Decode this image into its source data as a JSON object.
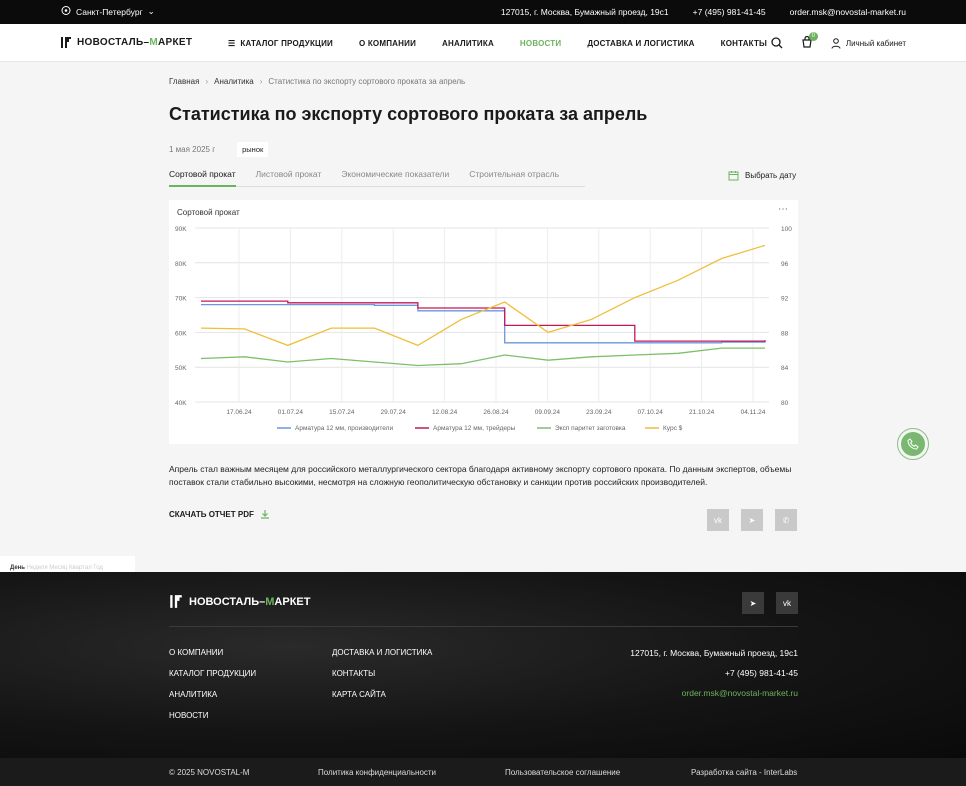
{
  "topbar": {
    "city": "Санкт-Петербург",
    "address": "127015, г. Москва, Бумажный проезд, 19с1",
    "phone": "+7 (495) 981-41-45",
    "email": "order.msk@novostal-market.ru"
  },
  "logo": {
    "part1": "НОВОСТАЛЬ–",
    "part2": "М",
    "part3": "АРКЕТ"
  },
  "nav": {
    "catalog": "КАТАЛОГ ПРОДУКЦИИ",
    "about": "О КОМПАНИИ",
    "analytics": "АНАЛИТИКА",
    "news": "НОВОСТИ",
    "delivery": "ДОСТАВКА И ЛОГИСТИКА",
    "contacts": "КОНТАКТЫ"
  },
  "header": {
    "cart_count": "0",
    "account": "Личный кабинет"
  },
  "breadcrumb": {
    "home": "Главная",
    "section": "Аналитика",
    "current": "Статистика по экспорту сортового проката за апрель"
  },
  "article": {
    "title": "Статистика по экспорту сортового проката за апрель",
    "date": "1 мая 2025 г",
    "tag": "рынок",
    "description": "Апрель стал важным месяцем для российского металлургического сектора благодаря активному экспорту сортового проката. По данным экспертов, объемы поставок стали стабильно высокими, несмотря на сложную геополитическую обстановку и санкции против российских производителей.",
    "pdf": "СКАЧАТЬ ОТЧЕТ PDF"
  },
  "tabs": [
    "Сортовой прокат",
    "Листовой прокат",
    "Экономические показатели",
    "Строительная отрасль"
  ],
  "date_picker": "Выбрать дату",
  "chart_title": "Сортовой прокат",
  "chart_data": {
    "type": "line",
    "x": [
      "17.06.24",
      "01.07.24",
      "15.07.24",
      "29.07.24",
      "12.08.24",
      "26.08.24",
      "09.09.24",
      "23.09.24",
      "07.10.24",
      "21.10.24",
      "04.11.24"
    ],
    "y_left_ticks": [
      "40K",
      "50K",
      "60K",
      "70K",
      "80K",
      "90K"
    ],
    "y_right_ticks": [
      "80",
      "84",
      "88",
      "92",
      "96",
      "100"
    ],
    "ylim_left": [
      40000,
      90000
    ],
    "ylim_right": [
      80,
      100
    ],
    "grid": true,
    "legend_position": "bottom",
    "series": [
      {
        "name": "Арматура 12 мм, производители",
        "color": "#6e96e0",
        "axis": "left",
        "values": [
          68000,
          68000,
          68000,
          68000,
          67800,
          66200,
          66200,
          57000,
          57000,
          57000,
          57000,
          57000,
          57200,
          57500
        ]
      },
      {
        "name": "Арматура 12 мм, трейдеры",
        "color": "#c2185b",
        "axis": "left",
        "values": [
          69000,
          69000,
          68500,
          68500,
          68500,
          67000,
          67000,
          62000,
          62000,
          62000,
          57500,
          57500,
          57500,
          57800
        ]
      },
      {
        "name": "Эксп паритет заготовка",
        "color": "#7cc06a",
        "axis": "left",
        "values": [
          52500,
          53000,
          51500,
          52500,
          51500,
          50500,
          51000,
          53500,
          52000,
          53000,
          53500,
          54000,
          55500,
          55500
        ]
      },
      {
        "name": "Курс $",
        "color": "#f0be3c",
        "axis": "right",
        "values": [
          88.5,
          88.4,
          86.5,
          88.5,
          88.5,
          86.5,
          89.5,
          91.5,
          88,
          89.5,
          92,
          94,
          96.5,
          98
        ]
      }
    ]
  },
  "footer": {
    "col1": [
      "О КОМПАНИИ",
      "КАТАЛОГ ПРОДУКЦИИ",
      "АНАЛИТИКА",
      "НОВОСТИ"
    ],
    "col2": [
      "ДОСТАВКА И ЛОГИСТИКА",
      "КОНТАКТЫ",
      "КАРТА САЙТА"
    ],
    "address": "127015, г. Москва, Бумажный проезд, 19с1",
    "phone": "+7 (495) 981-41-45",
    "email": "order.msk@novostal-market.ru",
    "copyright": "© 2025 NOVOSTAL-M",
    "privacy": "Политика конфиденциальности",
    "agreement": "Пользовательское соглашение",
    "developer": "Разработка сайта - InterLabs"
  },
  "leftsnip": {
    "day": "День",
    "rest": "Неделя  Месяц  Квартал  Год"
  },
  "colors": {
    "accent": "#6db35f",
    "dark": "#0b0b0b"
  }
}
